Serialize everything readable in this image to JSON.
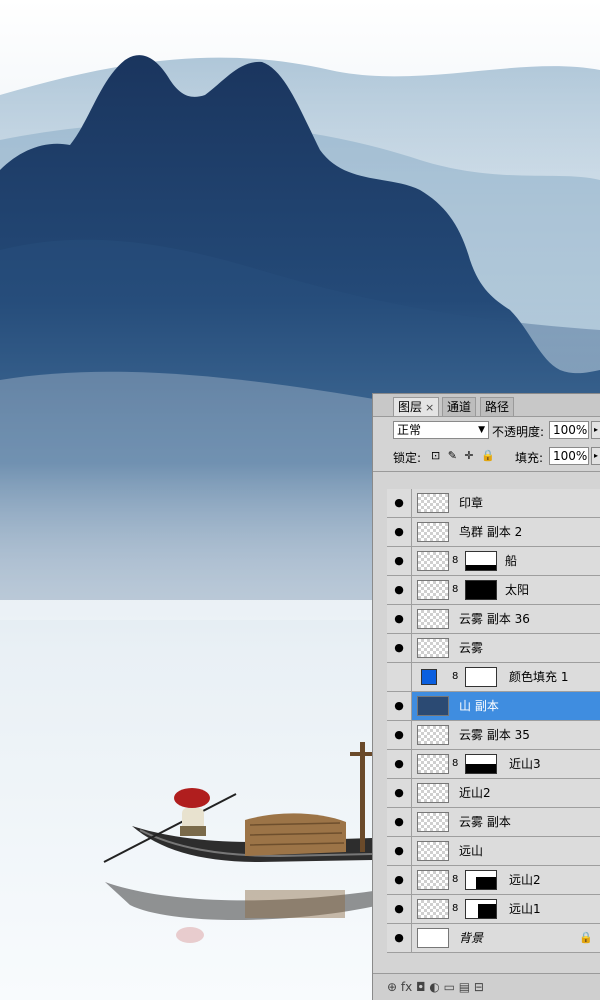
{
  "panel": {
    "tabs": [
      {
        "label": "图层",
        "close": "×"
      },
      {
        "label": "通道"
      },
      {
        "label": "路径"
      }
    ],
    "blend_mode": "正常",
    "blend_arrow": "▼",
    "opacity_label": "不透明度:",
    "opacity_value": "100%",
    "lock_label": "锁定:",
    "lock_icons": "⊡ ✎ ✛ 🔒",
    "fill_label": "填充:",
    "fill_value": "100%",
    "fly_arrow": "▸",
    "eye_glyph": "●",
    "chain_glyph": "8",
    "layers": [
      {
        "name": "印章"
      },
      {
        "name": "鸟群 副本 2"
      },
      {
        "name": "船"
      },
      {
        "name": "太阳"
      },
      {
        "name": "云雾 副本 36"
      },
      {
        "name": "云雾"
      },
      {
        "name": "颜色填充 1"
      },
      {
        "name": "山 副本"
      },
      {
        "name": "云雾 副本 35"
      },
      {
        "name": "近山3"
      },
      {
        "name": "近山2"
      },
      {
        "name": "云雾 副本"
      },
      {
        "name": "远山"
      },
      {
        "name": "远山2"
      },
      {
        "name": "远山1"
      },
      {
        "name": "背景",
        "lock": "🔒"
      }
    ],
    "bottom_icons": "⊕ fx ◘ ◐ ▭ ▤ ⊟"
  },
  "colors": {
    "mountain_dark": "#1b3b66",
    "mountain_mid": "#35608c",
    "mist": "#cfdde8",
    "selected_layer": "#3f8de0",
    "color_fill_swatch": "#0a5fe0"
  }
}
